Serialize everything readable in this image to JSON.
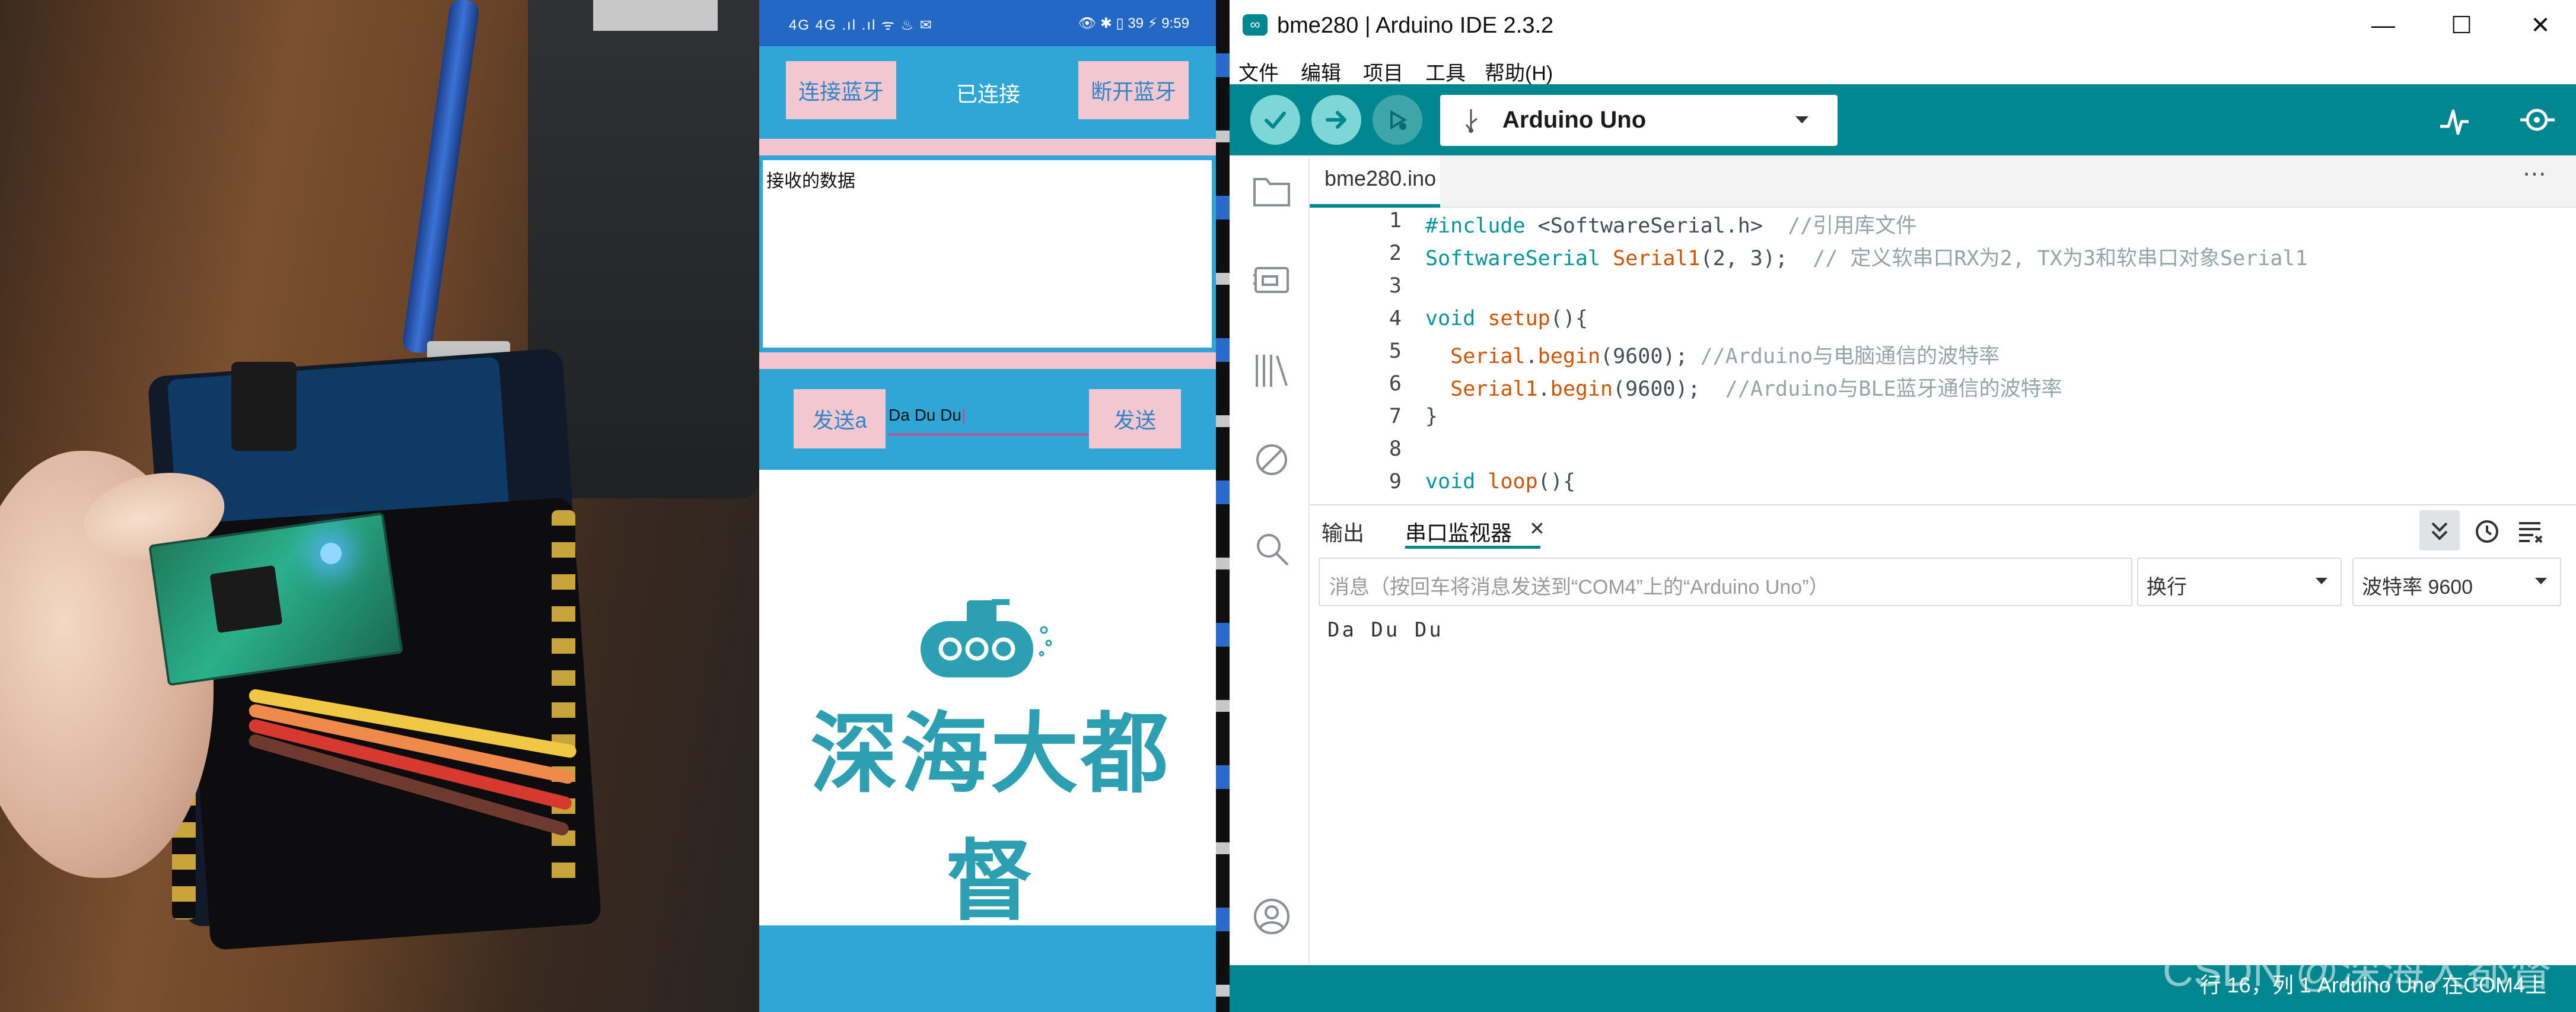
{
  "phone": {
    "status_left": "4G 4G .ıl .ıl ᯤ ♨ ✉",
    "status_right": "👁 ✱ ▯ 39 ⚡ 9:59",
    "connect_btn": "连接蓝牙",
    "status": "已连接",
    "disconnect_btn": "断开蓝牙",
    "rx_label": "接收的数据",
    "send_a_btn": "发送a",
    "send_input": "Da Du Du",
    "send_btn": "发送",
    "logo_text": "深海大都督",
    "colors": {
      "header": "#2468c6",
      "background": "#2fa6d6",
      "button": "#f2c7cf",
      "logo": "#2d9fb3"
    }
  },
  "ide": {
    "app_icon": "∞",
    "title": "bme280 | Arduino IDE 2.3.2",
    "window_controls": {
      "minimize": "—",
      "maximize": "☐",
      "close": "✕"
    },
    "menu": [
      "文件",
      "编辑",
      "项目",
      "工具",
      "帮助(H)"
    ],
    "toolbar": {
      "verify_icon": "check-icon",
      "upload_icon": "arrow-right-icon",
      "debug_icon": "debug-icon",
      "board_usb_icon": "usb-icon",
      "board": "Arduino Uno",
      "plotter_icon": "pulse-icon",
      "serial_monitor_icon": "magnifier-icon"
    },
    "tab": "bme280.ino",
    "tab_more": "⋯",
    "code_lines": [
      {
        "n": "1",
        "text": "#include <SoftwareSerial.h>  //引用库文件"
      },
      {
        "n": "2",
        "text": "SoftwareSerial Serial1(2, 3);  // 定义软串口RX为2, TX为3和软串口对象Serial1"
      },
      {
        "n": "3",
        "text": ""
      },
      {
        "n": "4",
        "text": "void setup(){"
      },
      {
        "n": "5",
        "text": "  Serial.begin(9600); //Arduino与电脑通信的波特率"
      },
      {
        "n": "6",
        "text": "  Serial1.begin(9600);  //Arduino与BLE蓝牙通信的波特率"
      },
      {
        "n": "7",
        "text": "}"
      },
      {
        "n": "8",
        "text": ""
      },
      {
        "n": "9",
        "text": "void loop(){"
      }
    ],
    "panel_tabs": {
      "output": "输出",
      "serial_monitor": "串口监视器",
      "close": "✕"
    },
    "message_placeholder": "消息（按回车将消息发送到“COM4”上的“Arduino Uno”）",
    "line_ending": "换行",
    "baud": "波特率 9600",
    "serial_output": "Da  Du  Du",
    "status": "行 16，列 1    Arduino Uno 在COM4上",
    "watermark": "CSDN @深海大都督",
    "accent": "#00878f"
  }
}
